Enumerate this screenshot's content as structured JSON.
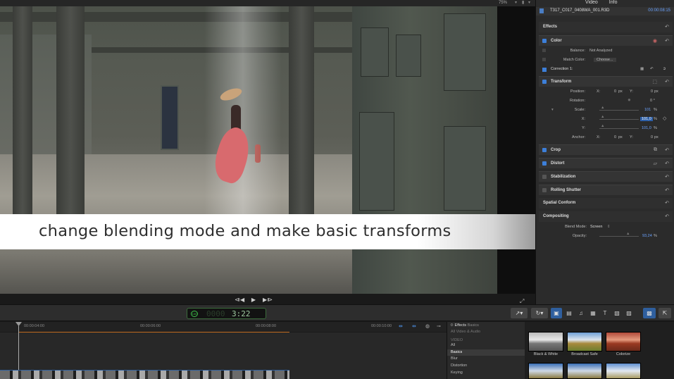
{
  "app": {
    "zoom_label": "75%",
    "topbar_menu_icon": "chevron-down-icon",
    "topbar_meter_icon": "audio-meter-icon"
  },
  "viewer": {
    "caption": "change blending mode and make basic transforms",
    "transport": {
      "prev": "⧏◀",
      "play": "▶",
      "next": "▶⧐"
    },
    "fullscreen_glyph": "⤢"
  },
  "inspector": {
    "tabs": [
      "Video",
      "Info"
    ],
    "clip_name": "T317_C017_0408WA_001.R3D",
    "clip_timecode": "00:00:08:15",
    "effects_header": "Effects",
    "color": {
      "label": "Color",
      "balance_label": "Balance:",
      "balance_value": "Not Analyzed",
      "match_label": "Match Color:",
      "match_value": "Choose...",
      "correction_label": "Correction 1:"
    },
    "transform": {
      "label": "Transform",
      "position_label": "Position:",
      "position_x_label": "X:",
      "position_x": "0",
      "position_y_label": "Y:",
      "position_y": "0",
      "unit_px": "px",
      "rotation_label": "Rotation:",
      "rotation_value": "0 °",
      "scale_label": "Scale:",
      "scale_value": "101",
      "scale_pct": "%",
      "scale_x_label": "X:",
      "scale_x_value": "101,0",
      "scale_y_label": "Y:",
      "scale_y_value": "101,0",
      "anchor_label": "Anchor:",
      "anchor_x_label": "X:",
      "anchor_x": "0",
      "anchor_y_label": "Y:",
      "anchor_y": "0"
    },
    "crop_label": "Crop",
    "distort_label": "Distort",
    "stabilization_label": "Stabilization",
    "rolling_shutter_label": "Rolling Shutter",
    "spatial_conform_label": "Spatial Conform",
    "compositing": {
      "label": "Compositing",
      "blend_label": "Blend Mode:",
      "blend_value": "Screen",
      "opacity_label": "Opacity:",
      "opacity_value": "93,24",
      "opacity_pct": "%"
    },
    "reset_glyph": "↶"
  },
  "toolbar": {
    "timecode_badge": "100",
    "timecode_dim": "0000",
    "timecode_value": "3:22",
    "tools": [
      "↗▾",
      "↻▾",
      "▣",
      "▤",
      "♫",
      "▦",
      "T",
      "▧",
      "▨",
      "▩",
      "⇱"
    ]
  },
  "timeline": {
    "ticks": [
      "00:00:04:00",
      "00:00:06:00",
      "00:00:08:00",
      "00:00:10:00"
    ]
  },
  "effects_browser": {
    "title": "Effects",
    "crumb": "Basics",
    "items": [
      {
        "label": "All Video & Audio",
        "state": "dim"
      },
      {
        "label": "VIDEO",
        "state": "dim"
      },
      {
        "label": "All",
        "state": "normal"
      },
      {
        "label": "Basics",
        "state": "selected"
      },
      {
        "label": "Blur",
        "state": "normal"
      },
      {
        "label": "Distortion",
        "state": "normal"
      },
      {
        "label": "Keying",
        "state": "normal"
      }
    ],
    "thumbs": [
      "Black & White",
      "Broadcast Safe",
      "Colorize"
    ]
  }
}
